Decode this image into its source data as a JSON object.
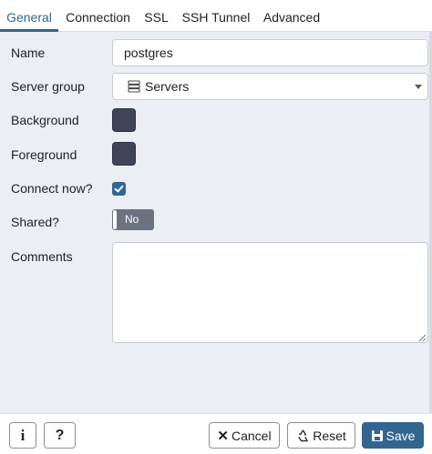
{
  "tabs": [
    {
      "label": "General",
      "active": true
    },
    {
      "label": "Connection",
      "active": false
    },
    {
      "label": "SSL",
      "active": false
    },
    {
      "label": "SSH Tunnel",
      "active": false
    },
    {
      "label": "Advanced",
      "active": false
    }
  ],
  "form": {
    "name": {
      "label": "Name",
      "value": "postgres"
    },
    "server_group": {
      "label": "Server group",
      "value": "Servers",
      "icon": "server-group-icon"
    },
    "background": {
      "label": "Background",
      "color": "#3f4457"
    },
    "foreground": {
      "label": "Foreground",
      "color": "#3f4457"
    },
    "connect_now": {
      "label": "Connect now?",
      "checked": true
    },
    "shared": {
      "label": "Shared?",
      "state": "No"
    },
    "comments": {
      "label": "Comments",
      "value": ""
    }
  },
  "footer": {
    "info_label": "i",
    "help_label": "?",
    "cancel_label": "Cancel",
    "reset_label": "Reset",
    "save_label": "Save"
  },
  "colors": {
    "accent": "#326690",
    "panel_bg": "#ebeef3",
    "toggle_off": "#6b7380"
  }
}
